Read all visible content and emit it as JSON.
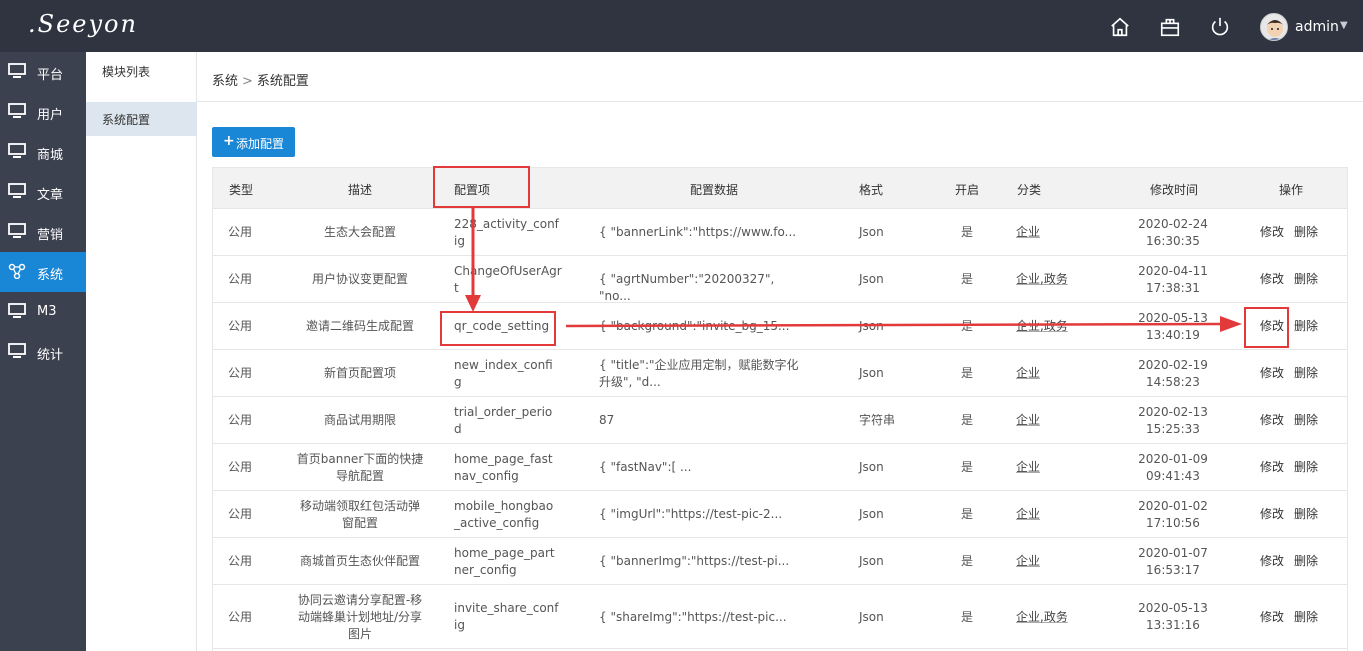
{
  "app": {
    "logo_text": ".Seeyon"
  },
  "topbar": {
    "user_name": "admin",
    "icons": [
      "home-icon",
      "shop-icon",
      "power-icon"
    ]
  },
  "nav": {
    "items": [
      {
        "label": "平台",
        "icon": "monitor-icon"
      },
      {
        "label": "用户",
        "icon": "monitor-icon"
      },
      {
        "label": "商城",
        "icon": "monitor-icon"
      },
      {
        "label": "文章",
        "icon": "monitor-icon"
      },
      {
        "label": "营销",
        "icon": "monitor-icon"
      },
      {
        "label": "系统",
        "icon": "network-icon",
        "active": true
      },
      {
        "label": "M3",
        "icon": "monitor-icon"
      },
      {
        "label": "统计",
        "icon": "monitor-icon"
      }
    ]
  },
  "subnav": {
    "items": [
      {
        "label": "模块列表"
      },
      {
        "label": "系统配置",
        "active": true
      }
    ]
  },
  "breadcrumb": {
    "root": "系统",
    "separator": ">",
    "current": "系统配置"
  },
  "toolbar": {
    "add_label": "添加配置"
  },
  "table": {
    "headers": [
      "类型",
      "描述",
      "配置项",
      "配置数据",
      "格式",
      "开启",
      "分类",
      "修改时间",
      "操作"
    ],
    "actions": {
      "edit": "修改",
      "delete": "删除"
    },
    "rows": [
      {
        "type": "公用",
        "desc": [
          "生态大会配置"
        ],
        "key": [
          "228_activity_conf",
          "ig"
        ],
        "data": [
          "{ \"bannerLink\":\"https://www.fo..."
        ],
        "format": "Json",
        "enabled": "是",
        "category": [
          "企业"
        ],
        "date": "2020-02-24",
        "time": "16:30:35"
      },
      {
        "type": "公用",
        "desc": [
          "用户协议变更配置"
        ],
        "key": [
          "ChangeOfUserAgr",
          "t"
        ],
        "data": [
          "{ \"agrtNumber\":\"20200327\", \"no..."
        ],
        "format": "Json",
        "enabled": "是",
        "category": [
          "企业",
          "政务"
        ],
        "date": "2020-04-11",
        "time": "17:38:31"
      },
      {
        "type": "公用",
        "desc": [
          "邀请二维码生成配置"
        ],
        "key": [
          "qr_code_setting"
        ],
        "data": [
          "{ \"background\":\"invite_bg_15..."
        ],
        "format": "Json",
        "enabled": "是",
        "category": [
          "企业",
          "政务"
        ],
        "date": "2020-05-13",
        "time": "13:40:19"
      },
      {
        "type": "公用",
        "desc": [
          "新首页配置项"
        ],
        "key": [
          "new_index_confi",
          "g"
        ],
        "data": [
          "{ \"title\":\"企业应用定制，赋能数字化",
          "升级\", \"d..."
        ],
        "format": "Json",
        "enabled": "是",
        "category": [
          "企业"
        ],
        "date": "2020-02-19",
        "time": "14:58:23"
      },
      {
        "type": "公用",
        "desc": [
          "商品试用期限"
        ],
        "key": [
          "trial_order_perio",
          "d"
        ],
        "data": [
          "87"
        ],
        "format": "字符串",
        "enabled": "是",
        "category": [
          "企业"
        ],
        "date": "2020-02-13",
        "time": "15:25:33"
      },
      {
        "type": "公用",
        "desc": [
          "首页banner下面的快捷",
          "导航配置"
        ],
        "key": [
          "home_page_fast",
          "nav_config"
        ],
        "data": [
          "{ \"fastNav\":[ ..."
        ],
        "format": "Json",
        "enabled": "是",
        "category": [
          "企业"
        ],
        "date": "2020-01-09",
        "time": "09:41:43"
      },
      {
        "type": "公用",
        "desc": [
          "移动端领取红包活动弹",
          "窗配置"
        ],
        "key": [
          "mobile_hongbao",
          "_active_config"
        ],
        "data": [
          "{ \"imgUrl\":\"https://test-pic-2..."
        ],
        "format": "Json",
        "enabled": "是",
        "category": [
          "企业"
        ],
        "date": "2020-01-02",
        "time": "17:10:56"
      },
      {
        "type": "公用",
        "desc": [
          "商城首页生态伙伴配置"
        ],
        "key": [
          "home_page_part",
          "ner_config"
        ],
        "data": [
          "{ \"bannerImg\":\"https://test-pi..."
        ],
        "format": "Json",
        "enabled": "是",
        "category": [
          "企业"
        ],
        "date": "2020-01-07",
        "time": "16:53:17"
      },
      {
        "type": "公用",
        "desc": [
          "协同云邀请分享配置-移",
          "动端蜂巢计划地址/分享",
          "图片"
        ],
        "key": [
          "invite_share_conf",
          "ig"
        ],
        "data": [
          "{ \"shareImg\":\"https://test-pic..."
        ],
        "format": "Json",
        "enabled": "是",
        "category": [
          "企业",
          "政务"
        ],
        "date": "2020-05-13",
        "time": "13:31:16"
      }
    ]
  },
  "annotation_color": "#e23a3a"
}
